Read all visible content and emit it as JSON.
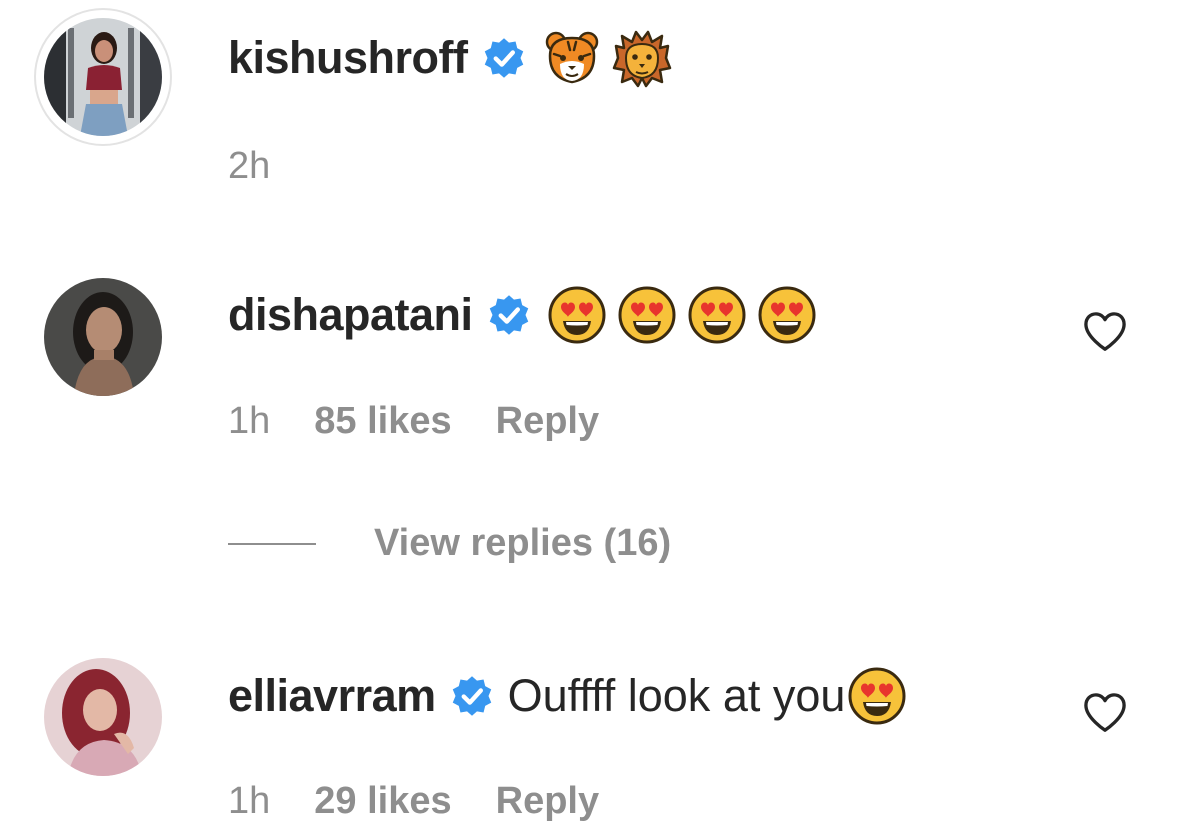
{
  "comments": [
    {
      "username": "kishushroff",
      "text": "",
      "emojis": [
        "tiger-face",
        "lion-face"
      ],
      "verified": true,
      "time": "2h",
      "likes": "",
      "reply_label": ""
    },
    {
      "username": "dishapatani",
      "text": "",
      "emojis": [
        "heart-eyes-face",
        "heart-eyes-face",
        "heart-eyes-face",
        "heart-eyes-face"
      ],
      "verified": true,
      "time": "1h",
      "likes": "85 likes",
      "reply_label": "Reply",
      "view_replies_label": "View replies (16)"
    },
    {
      "username": "elliavrram",
      "text": "Ouffff look at you",
      "emojis": [
        "heart-eyes-face"
      ],
      "verified": true,
      "time": "1h",
      "likes": "29 likes",
      "reply_label": "Reply"
    }
  ],
  "colors": {
    "text_primary": "#262626",
    "text_secondary": "#8e8e8e",
    "verified_blue": "#3897f0",
    "background": "#ffffff"
  },
  "icons": {
    "verified": "verified-badge-icon",
    "like": "heart-outline-icon"
  }
}
